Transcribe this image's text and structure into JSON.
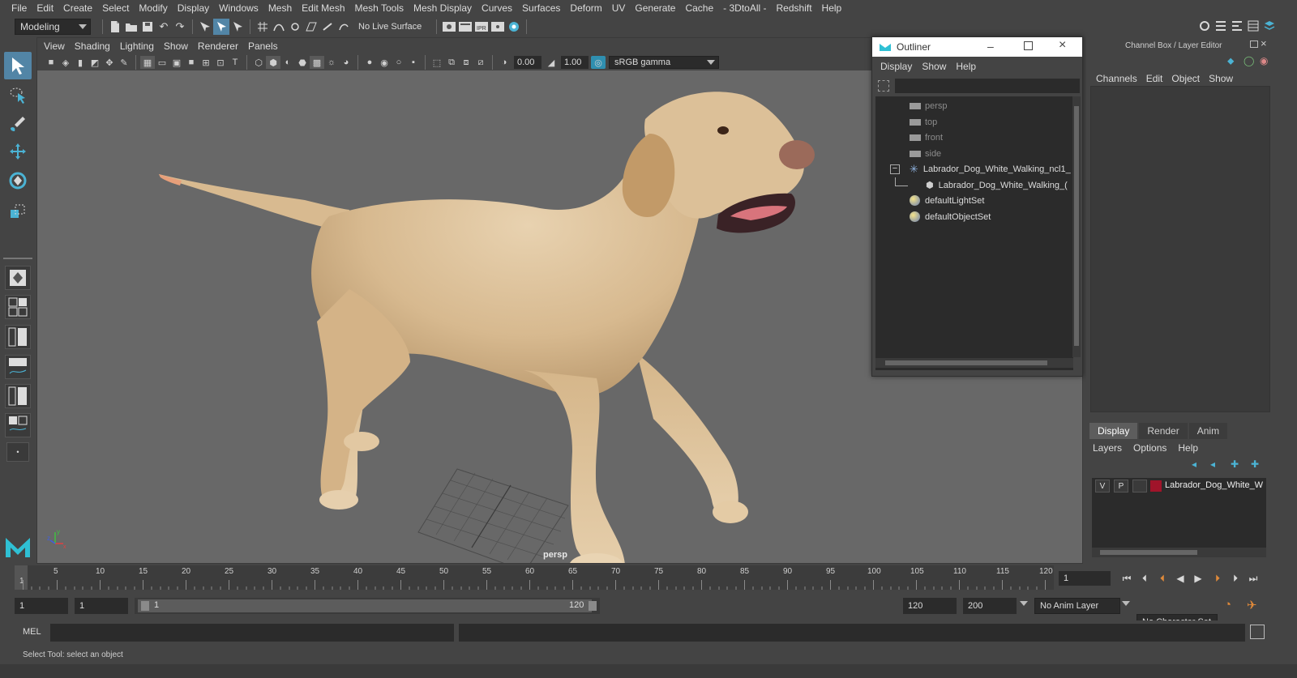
{
  "menubar": {
    "items": [
      "File",
      "Edit",
      "Create",
      "Select",
      "Modify",
      "Display",
      "Windows",
      "Mesh",
      "Edit Mesh",
      "Mesh Tools",
      "Mesh Display",
      "Curves",
      "Surfaces",
      "Deform",
      "UV",
      "Generate",
      "Cache",
      "- 3DtoAll -",
      "Redshift",
      "Help"
    ]
  },
  "statusline": {
    "mode": "Modeling",
    "live_surface": "No Live Surface"
  },
  "viewport": {
    "menu": [
      "View",
      "Shading",
      "Lighting",
      "Show",
      "Renderer",
      "Panels"
    ],
    "exposure": "0.00",
    "gamma": "1.00",
    "color_space": "sRGB gamma",
    "camera_label": "persp",
    "axis": {
      "x": "x",
      "y": "y",
      "z": "z"
    }
  },
  "outliner": {
    "title": "Outliner",
    "menu": [
      "Display",
      "Show",
      "Help"
    ],
    "items": [
      {
        "label": "persp"
      },
      {
        "label": "top"
      },
      {
        "label": "front"
      },
      {
        "label": "side"
      },
      {
        "label": "Labrador_Dog_White_Walking_ncl1_"
      },
      {
        "label": "Labrador_Dog_White_Walking_("
      },
      {
        "label": "defaultLightSet"
      },
      {
        "label": "defaultObjectSet"
      }
    ]
  },
  "channelbox": {
    "title": "Channel Box / Layer Editor",
    "menu": [
      "Channels",
      "Edit",
      "Object",
      "Show"
    ]
  },
  "layer_editor": {
    "tabs": [
      "Display",
      "Render",
      "Anim"
    ],
    "menu": [
      "Layers",
      "Options",
      "Help"
    ],
    "layer": {
      "v": "V",
      "p": "P",
      "name": "Labrador_Dog_White_W",
      "color": "#a0142a"
    }
  },
  "timeslider": {
    "labels": [
      "1",
      "5",
      "10",
      "15",
      "20",
      "25",
      "30",
      "35",
      "40",
      "45",
      "50",
      "55",
      "60",
      "65",
      "70",
      "75",
      "80",
      "85",
      "90",
      "95",
      "100",
      "105",
      "110",
      "115",
      "120"
    ],
    "current_frame": "1"
  },
  "range": {
    "start": "1",
    "anim_start": "1",
    "slider_start": "1",
    "slider_end": "120",
    "end": "120",
    "anim_end": "200",
    "anim_layer": "No Anim Layer",
    "character_set": "No Character Set"
  },
  "cmdline": {
    "label": "MEL"
  },
  "helpline": {
    "text": "Select Tool: select an object"
  },
  "colors": {
    "accent": "#5285a6",
    "panel": "#444444",
    "viewport_bg": "#686868",
    "field": "#2b2b2b"
  }
}
